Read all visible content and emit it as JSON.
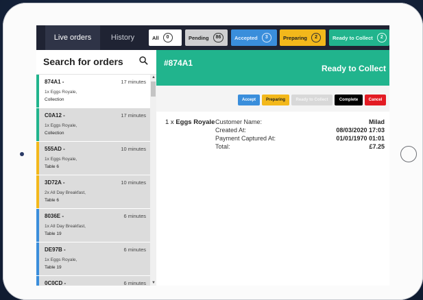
{
  "tabs": {
    "live": "Live orders",
    "history": "History"
  },
  "filters": [
    {
      "label": "All",
      "count": "0"
    },
    {
      "label": "Pending",
      "count": "86"
    },
    {
      "label": "Accepted",
      "count": "3"
    },
    {
      "label": "Preparing",
      "count": "2"
    },
    {
      "label": "Ready to Collect",
      "count": "2"
    }
  ],
  "sidebar": {
    "search_label": "Search for orders",
    "orders": [
      {
        "id": "874A1 -",
        "time": "17 minutes",
        "desc": "1x Eggs Royale,",
        "dest": "Collection",
        "status_color": "#21b48d"
      },
      {
        "id": "C0A12 -",
        "time": "17 minutes",
        "desc": "1x Eggs Royale,",
        "dest": "Collection",
        "status_color": "#21b48d"
      },
      {
        "id": "555AD -",
        "time": "10 minutes",
        "desc": "1x Eggs Royale,",
        "dest": "Table 6",
        "status_color": "#f3b81b"
      },
      {
        "id": "3D72A -",
        "time": "10 minutes",
        "desc": "2x All Day Breakfast,",
        "dest": "Table 6",
        "status_color": "#f3b81b"
      },
      {
        "id": "8036E -",
        "time": "6 minutes",
        "desc": "1x All Day Breakfast,",
        "dest": "Table 19",
        "status_color": "#3a8edb"
      },
      {
        "id": "DE97B -",
        "time": "6 minutes",
        "desc": "1x Eggs Royale,",
        "dest": "Table 19",
        "status_color": "#3a8edb"
      },
      {
        "id": "0C0CD -",
        "time": "6 minutes",
        "desc": "",
        "dest": "",
        "status_color": "#3a8edb"
      }
    ]
  },
  "main": {
    "order_number": "#874A1",
    "status": "Ready to Collect",
    "actions": {
      "accept": "Accept",
      "preparing": "Preparing",
      "ready": "Ready to Collect",
      "complete": "Complete",
      "cancel": "Cancel"
    },
    "item_qty": "1 x",
    "item_name": "Eggs Royale",
    "fields": [
      {
        "key": "Customer Name:",
        "value": "Milad"
      },
      {
        "key": "Created At:",
        "value": "08/03/2020 17:03"
      },
      {
        "key": "Payment Captured At:",
        "value": "01/01/1970 01:01"
      },
      {
        "key": "Total:",
        "value": "£7.25"
      }
    ]
  },
  "colors": {
    "accent": "#21b48d",
    "accepted": "#3a8edb",
    "preparing": "#f3b81b",
    "cancel": "#e31b23"
  }
}
